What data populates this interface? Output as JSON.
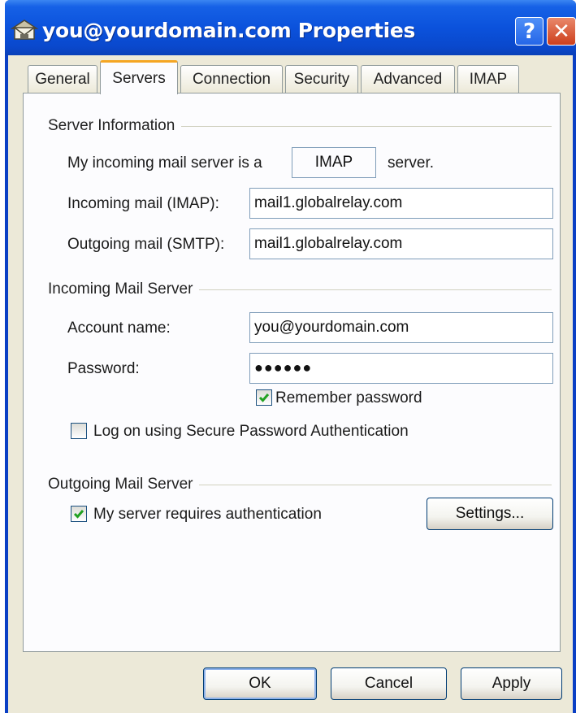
{
  "window": {
    "title": "you@yourdomain.com Properties",
    "help_label": "?",
    "close_label": "✕"
  },
  "tabs": [
    {
      "label": "General",
      "active": false
    },
    {
      "label": "Servers",
      "active": true
    },
    {
      "label": "Connection",
      "active": false
    },
    {
      "label": "Security",
      "active": false
    },
    {
      "label": "Advanced",
      "active": false
    },
    {
      "label": "IMAP",
      "active": false
    }
  ],
  "server_info": {
    "heading": "Server Information",
    "server_type_prefix": "My incoming mail server is a",
    "server_type_value": "IMAP",
    "server_type_suffix": "server.",
    "incoming_label": "Incoming mail (IMAP):",
    "incoming_value": "mail1.globalrelay.com",
    "outgoing_label": "Outgoing mail (SMTP):",
    "outgoing_value": "mail1.globalrelay.com"
  },
  "incoming_server": {
    "heading": "Incoming Mail Server",
    "account_label": "Account name:",
    "account_value": "you@yourdomain.com",
    "password_label": "Password:",
    "password_value": "●●●●●●",
    "remember_label": "Remember password",
    "remember_checked": true,
    "spa_label": "Log on using Secure Password Authentication",
    "spa_checked": false
  },
  "outgoing_server": {
    "heading": "Outgoing Mail Server",
    "auth_label": "My server requires authentication",
    "auth_checked": true,
    "settings_button": "Settings..."
  },
  "buttons": {
    "ok": "OK",
    "cancel": "Cancel",
    "apply": "Apply"
  },
  "colors": {
    "titlebar": "#0b52dc",
    "dialog_bg": "#ece9d8",
    "active_tab_accent": "#f5a623",
    "checkmark": "#21a121"
  }
}
